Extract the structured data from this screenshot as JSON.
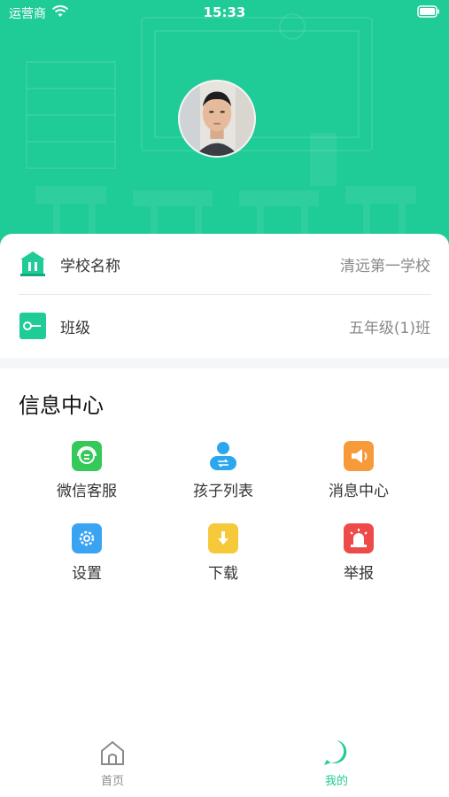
{
  "status_bar": {
    "carrier": "运营商",
    "time": "15:33"
  },
  "profile": {
    "avatar": "user-avatar-photo"
  },
  "info": {
    "school": {
      "label": "学校名称",
      "value": "清远第一学校",
      "icon": "school-building-icon"
    },
    "class": {
      "label": "班级",
      "value": "五年级(1)班",
      "icon": "class-key-icon"
    }
  },
  "info_center": {
    "title": "信息中心",
    "items": [
      {
        "label": "微信客服",
        "icon": "wechat-support-icon",
        "color": "#35c95a"
      },
      {
        "label": "孩子列表",
        "icon": "child-list-icon",
        "color": "#2aa7ee"
      },
      {
        "label": "消息中心",
        "icon": "megaphone-icon",
        "color": "#f79a3a"
      },
      {
        "label": "设置",
        "icon": "settings-gear-icon",
        "color": "#3aa4f2"
      },
      {
        "label": "下载",
        "icon": "download-icon",
        "color": "#f5c93a"
      },
      {
        "label": "举报",
        "icon": "alarm-siren-icon",
        "color": "#ef4a4a"
      }
    ]
  },
  "tabbar": {
    "home": {
      "label": "首页",
      "icon": "home-icon",
      "color": "#8a8a8a"
    },
    "mine": {
      "label": "我的",
      "icon": "profile-bubble-icon",
      "color": "#1fcb97"
    }
  },
  "colors": {
    "brand": "#1fcb97",
    "text_primary": "#333333",
    "text_secondary": "#888888"
  }
}
